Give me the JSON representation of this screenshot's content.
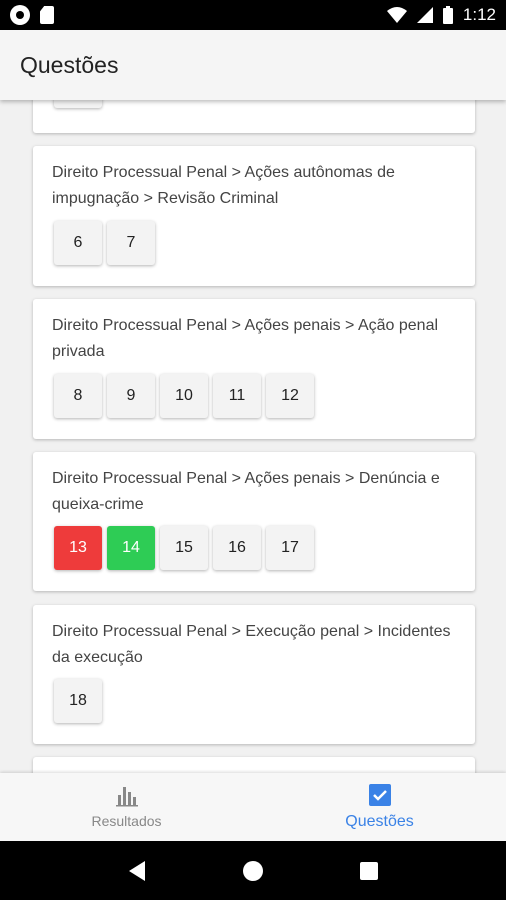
{
  "status_bar": {
    "time": "1:12"
  },
  "app_bar": {
    "title": "Questões"
  },
  "cards": [
    {
      "topic": "",
      "questions": [
        {
          "label": ""
        }
      ]
    },
    {
      "topic": "Direito Processual Penal > Ações autônomas de impugnação > Revisão Criminal",
      "questions": [
        {
          "label": "6"
        },
        {
          "label": "7"
        }
      ]
    },
    {
      "topic": "Direito Processual Penal > Ações penais > Ação penal privada",
      "questions": [
        {
          "label": "8"
        },
        {
          "label": "9"
        },
        {
          "label": "10"
        },
        {
          "label": "11"
        },
        {
          "label": "12"
        }
      ]
    },
    {
      "topic": "Direito Processual Penal > Ações penais > Denúncia e queixa-crime",
      "questions": [
        {
          "label": "13",
          "status": "wrong"
        },
        {
          "label": "14",
          "status": "right"
        },
        {
          "label": "15"
        },
        {
          "label": "16"
        },
        {
          "label": "17"
        }
      ]
    },
    {
      "topic": "Direito Processual Penal > Execução penal > Incidentes da execução",
      "questions": [
        {
          "label": "18"
        }
      ]
    },
    {
      "topic": "",
      "questions": []
    }
  ],
  "colors": {
    "wrong": "#ee3b3b",
    "right": "#2ecc55",
    "accent": "#3a82e6"
  },
  "bottom_nav": {
    "results_label": "Resultados",
    "results_icon": "bar-chart-icon",
    "questions_label": "Questões",
    "questions_icon": "checkbox-icon"
  }
}
